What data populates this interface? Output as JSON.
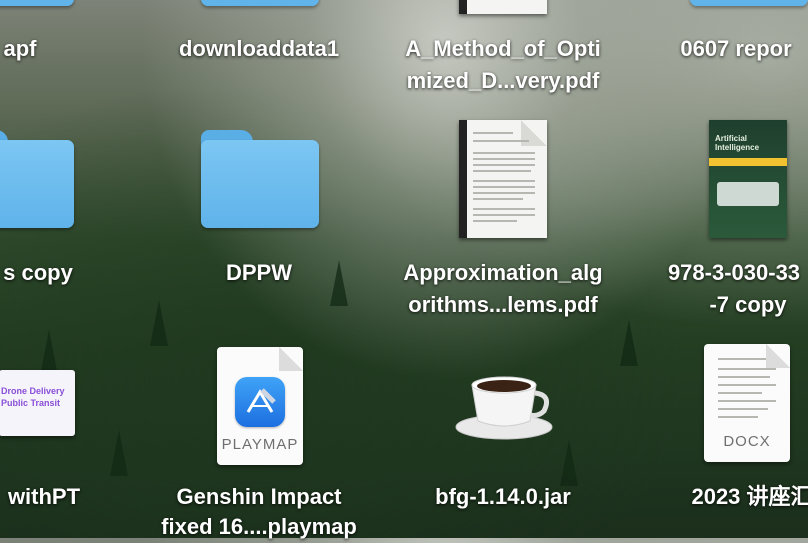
{
  "desktop": {
    "items": [
      {
        "label_lines": [
          "apf"
        ],
        "kind": "folder"
      },
      {
        "label_lines": [
          "downloaddata1"
        ],
        "kind": "folder"
      },
      {
        "label_lines": [
          "A_Method_of_Opti",
          "mized_D...very.pdf"
        ],
        "kind": "pdf"
      },
      {
        "label_lines": [
          "0607 repor"
        ],
        "kind": "folder"
      },
      {
        "label_lines": [
          "s copy"
        ],
        "kind": "folder"
      },
      {
        "label_lines": [
          "DPPW"
        ],
        "kind": "folder"
      },
      {
        "label_lines": [
          "Approximation_alg",
          "orithms...lems.pdf"
        ],
        "kind": "pdf"
      },
      {
        "label_lines": [
          "978-3-030-33",
          "-7 copy"
        ],
        "kind": "book-pdf"
      },
      {
        "label_lines": [
          "withPT"
        ],
        "kind": "slides",
        "thumb_lines": [
          "Drone Delivery",
          "Public Transit"
        ]
      },
      {
        "label_lines": [
          "Genshin Impact",
          "fixed 16....playmap"
        ],
        "kind": "playmap",
        "badge": "PLAYMAP"
      },
      {
        "label_lines": [
          "bfg-1.14.0.jar"
        ],
        "kind": "jar"
      },
      {
        "label_lines": [
          "2023 讲座汇"
        ],
        "kind": "docx",
        "badge": "DOCX"
      }
    ],
    "book_cover_title": "Artificial Intelligence",
    "colors": {
      "folder": "#5fb3ea",
      "label": "#ffffff"
    }
  }
}
